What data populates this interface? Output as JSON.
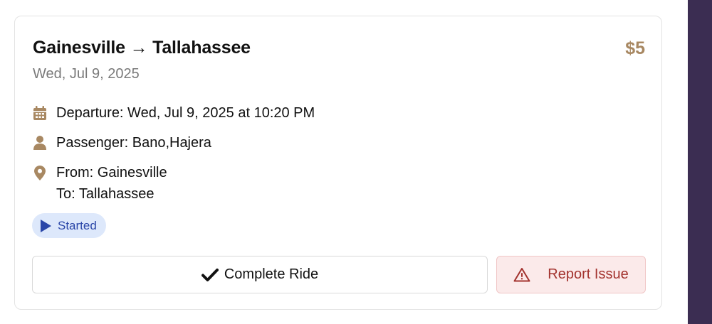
{
  "ride": {
    "origin": "Gainesville",
    "destination": "Tallahassee",
    "arrow": "→",
    "price": "$5",
    "date": "Wed, Jul 9, 2025",
    "departure_text": "Departure: Wed, Jul 9, 2025 at 10:20 PM",
    "passenger_text": "Passenger: Bano,Hajera",
    "from_text": "From: Gainesville",
    "to_text": "To: Tallahassee",
    "status": "Started"
  },
  "actions": {
    "complete_label": "Complete Ride",
    "report_label": "Report Issue"
  },
  "icons": {
    "calendar": "calendar-icon",
    "passenger": "user-icon",
    "location": "map-pin-icon",
    "status": "play-icon",
    "complete": "checkmark-icon",
    "report": "warning-triangle-icon"
  },
  "colors": {
    "accent": "#a88862",
    "status_bg": "#dde8fb",
    "status_fg": "#2a46a8",
    "danger_bg": "#fbeaea",
    "danger_fg": "#a3332e"
  }
}
